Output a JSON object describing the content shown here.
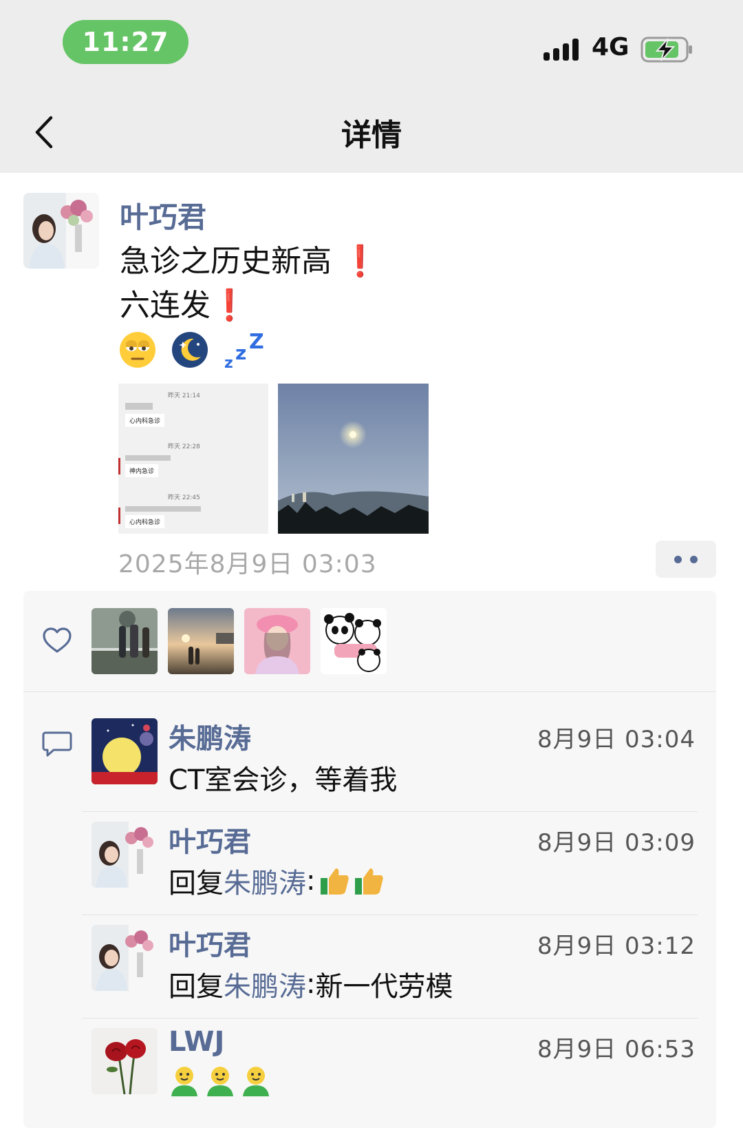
{
  "status_bar": {
    "time": "11:27",
    "network": "4G"
  },
  "nav": {
    "title": "详情"
  },
  "post": {
    "author": "叶巧君",
    "lines": [
      "急诊之历史新高",
      "六连发"
    ],
    "exclaim": "❗",
    "thumb1_entries": [
      {
        "time": "昨天 21:14",
        "msg": "心内科急诊"
      },
      {
        "time": "昨天 22:28",
        "msg": "神内急诊"
      },
      {
        "time": "昨天 22:45",
        "msg": "心内科急诊"
      }
    ],
    "time": "2025年8月9日 03:03"
  },
  "comments": [
    {
      "name": "朱鹏涛",
      "time": "8月9日 03:04",
      "text": "CT室会诊，等着我"
    },
    {
      "name": "叶巧君",
      "time": "8月9日 03:09",
      "reply_word": "回复",
      "reply_to": "朱鹏涛",
      "colon": ":",
      "text": ""
    },
    {
      "name": "叶巧君",
      "time": "8月9日 03:12",
      "reply_word": "回复",
      "reply_to": "朱鹏涛",
      "colon": ":",
      "text": " 新一代劳模"
    },
    {
      "name": "LWJ",
      "time": "8月9日 06:53",
      "text": ""
    }
  ],
  "colors": {
    "link": "#576b95",
    "status_pill": "#65c466",
    "panel_bg": "#f7f7f7",
    "nav_bg": "#ededed"
  }
}
